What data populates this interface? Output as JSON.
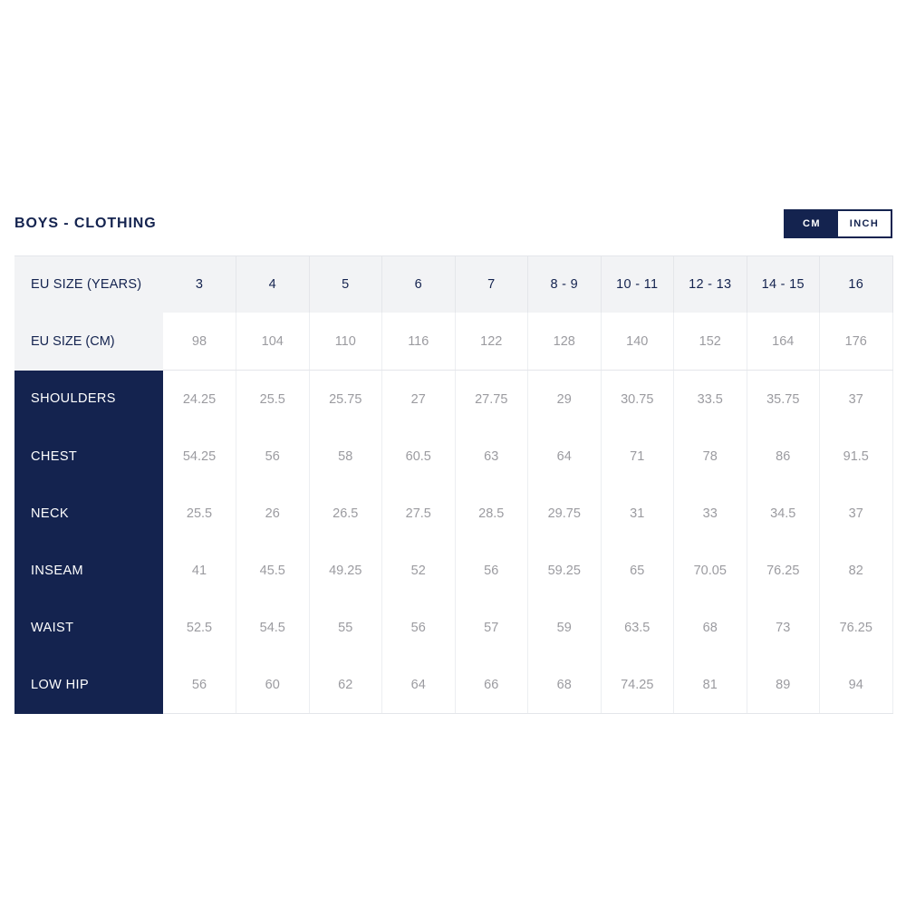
{
  "header": {
    "title": "BOYS - CLOTHING"
  },
  "unit_toggle": {
    "options": [
      {
        "label": "CM",
        "active": true
      },
      {
        "label": "INCH",
        "active": false
      }
    ]
  },
  "colors": {
    "navy": "#14234f",
    "header_row_bg": "#f2f3f5",
    "value_text": "#9b9ba0",
    "border": "#e4e6ea"
  },
  "table": {
    "size_header_label": "EU SIZE (YEARS)",
    "size_headers": [
      "3",
      "4",
      "5",
      "6",
      "7",
      "8 - 9",
      "10 - 11",
      "12 - 13",
      "14 - 15",
      "16"
    ],
    "cm_header_label": "EU SIZE (CM)",
    "cm_values": [
      "98",
      "104",
      "110",
      "116",
      "122",
      "128",
      "140",
      "152",
      "164",
      "176"
    ],
    "rows": [
      {
        "label": "SHOULDERS",
        "values": [
          "24.25",
          "25.5",
          "25.75",
          "27",
          "27.75",
          "29",
          "30.75",
          "33.5",
          "35.75",
          "37"
        ]
      },
      {
        "label": "CHEST",
        "values": [
          "54.25",
          "56",
          "58",
          "60.5",
          "63",
          "64",
          "71",
          "78",
          "86",
          "91.5"
        ]
      },
      {
        "label": "NECK",
        "values": [
          "25.5",
          "26",
          "26.5",
          "27.5",
          "28.5",
          "29.75",
          "31",
          "33",
          "34.5",
          "37"
        ]
      },
      {
        "label": "INSEAM",
        "values": [
          "41",
          "45.5",
          "49.25",
          "52",
          "56",
          "59.25",
          "65",
          "70.05",
          "76.25",
          "82"
        ]
      },
      {
        "label": "WAIST",
        "values": [
          "52.5",
          "54.5",
          "55",
          "56",
          "57",
          "59",
          "63.5",
          "68",
          "73",
          "76.25"
        ]
      },
      {
        "label": "LOW HIP",
        "values": [
          "56",
          "60",
          "62",
          "64",
          "66",
          "68",
          "74.25",
          "81",
          "89",
          "94"
        ]
      }
    ]
  }
}
